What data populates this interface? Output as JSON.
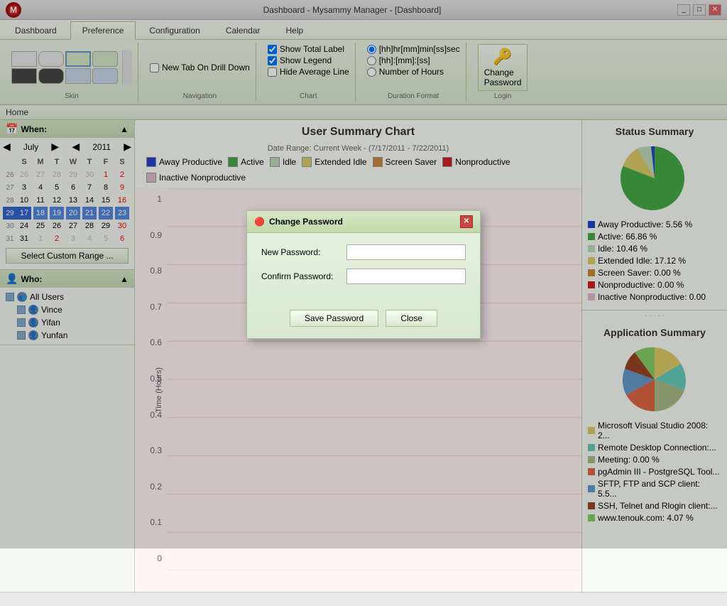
{
  "titleBar": {
    "text": "Dashboard - Mysammy Manager - [Dashboard]",
    "buttons": [
      "_",
      "□",
      "✕"
    ]
  },
  "ribbon": {
    "tabs": [
      "Dashboard",
      "Preference",
      "Configuration",
      "Calendar",
      "Help"
    ],
    "activeTab": "Preference",
    "groups": {
      "skin": {
        "label": "Skin"
      },
      "navigation": {
        "label": "Navigation",
        "newTabOnDrillDown": {
          "label": "New Tab On Drill Down",
          "checked": false
        }
      },
      "chart": {
        "label": "Chart",
        "showTotalLabel": {
          "label": "Show Total Label",
          "checked": true
        },
        "showLegend": {
          "label": "Show Legend",
          "checked": true
        },
        "hideAverageLine": {
          "label": "Hide Average Line",
          "checked": false
        }
      },
      "durationFormat": {
        "label": "Duration Format",
        "options": [
          {
            "label": "[hh]hr[mm]min[ss]sec",
            "value": "hhmmsssec",
            "checked": true
          },
          {
            "label": "[hh]:[mm]:[ss]",
            "value": "hhmmss",
            "checked": false
          },
          {
            "label": "Number of Hours",
            "value": "hours",
            "checked": false
          }
        ]
      },
      "login": {
        "label": "Login",
        "changePassword": "Change\nPassword"
      }
    }
  },
  "homeTab": "Home",
  "leftPanel": {
    "when": {
      "title": "When:",
      "month": "July",
      "year": "2011",
      "calHeaders": [
        "S",
        "M",
        "T",
        "W",
        "T",
        "F",
        "S"
      ],
      "weeks": [
        {
          "num": "26",
          "days": [
            {
              "d": "26",
              "cls": "other-month"
            },
            {
              "d": "27",
              "cls": "other-month"
            },
            {
              "d": "28",
              "cls": "other-month"
            },
            {
              "d": "29",
              "cls": "other-month"
            },
            {
              "d": "30",
              "cls": "other-month"
            },
            {
              "d": "1",
              "cls": "red"
            },
            {
              "d": "2",
              "cls": "red"
            }
          ]
        },
        {
          "num": "27",
          "days": [
            {
              "d": "3",
              "cls": ""
            },
            {
              "d": "4",
              "cls": ""
            },
            {
              "d": "5",
              "cls": ""
            },
            {
              "d": "6",
              "cls": ""
            },
            {
              "d": "7",
              "cls": ""
            },
            {
              "d": "8",
              "cls": ""
            },
            {
              "d": "9",
              "cls": "red"
            }
          ]
        },
        {
          "num": "28",
          "days": [
            {
              "d": "10",
              "cls": ""
            },
            {
              "d": "11",
              "cls": ""
            },
            {
              "d": "12",
              "cls": ""
            },
            {
              "d": "13",
              "cls": ""
            },
            {
              "d": "14",
              "cls": ""
            },
            {
              "d": "15",
              "cls": ""
            },
            {
              "d": "16",
              "cls": "red"
            }
          ]
        },
        {
          "num": "29",
          "days": [
            {
              "d": "17",
              "cls": "highlight"
            },
            {
              "d": "18",
              "cls": "highlight"
            },
            {
              "d": "19",
              "cls": "highlight"
            },
            {
              "d": "20",
              "cls": "highlight"
            },
            {
              "d": "21",
              "cls": "highlight"
            },
            {
              "d": "22",
              "cls": "highlight"
            },
            {
              "d": "23",
              "cls": "red highlight"
            }
          ]
        },
        {
          "num": "30",
          "days": [
            {
              "d": "24",
              "cls": ""
            },
            {
              "d": "25",
              "cls": ""
            },
            {
              "d": "26",
              "cls": ""
            },
            {
              "d": "27",
              "cls": ""
            },
            {
              "d": "28",
              "cls": ""
            },
            {
              "d": "29",
              "cls": ""
            },
            {
              "d": "30",
              "cls": "red"
            }
          ]
        },
        {
          "num": "31",
          "days": [
            {
              "d": "31",
              "cls": ""
            },
            {
              "d": "1",
              "cls": "other-month"
            },
            {
              "d": "2",
              "cls": "other-month red"
            },
            {
              "d": "3",
              "cls": "other-month"
            },
            {
              "d": "4",
              "cls": "other-month"
            },
            {
              "d": "5",
              "cls": "other-month"
            },
            {
              "d": "6",
              "cls": "other-month red"
            }
          ]
        }
      ],
      "customRangeBtn": "Select Custom Range ..."
    },
    "who": {
      "title": "Who:",
      "users": [
        {
          "name": "All Users",
          "level": 0
        },
        {
          "name": "Vince",
          "level": 1
        },
        {
          "name": "Yifan",
          "level": 1
        },
        {
          "name": "Yunfan",
          "level": 1
        }
      ]
    }
  },
  "chart": {
    "title": "User Summary Chart",
    "dateRange": "Date Range: Current Week - (7/17/2011 - 7/22/2011)",
    "legend": [
      {
        "label": "Away Productive",
        "color": "#2244cc"
      },
      {
        "label": "Active",
        "color": "#44aa44"
      },
      {
        "label": "Idle",
        "color": "#bbddbb"
      },
      {
        "label": "Extended Idle",
        "color": "#ddcc66"
      },
      {
        "label": "Screen Saver",
        "color": "#cc8833"
      },
      {
        "label": "Nonproductive",
        "color": "#cc2222"
      },
      {
        "label": "Inactive Nonproductive",
        "color": "#ddbbcc"
      }
    ],
    "yAxis": [
      "1",
      "0.9",
      "0.8",
      "0.7",
      "0.6",
      "0.5",
      "0.4",
      "0.3",
      "0.2",
      "0.1",
      "0"
    ]
  },
  "statusSummary": {
    "title": "Status Summary",
    "legend": [
      {
        "label": "Away Productive: 5.56 %",
        "color": "#2244cc"
      },
      {
        "label": "Active: 66.86 %",
        "color": "#44aa44"
      },
      {
        "label": "Idle: 10.46 %",
        "color": "#bbddbb"
      },
      {
        "label": "Extended Idle: 17.12 %",
        "color": "#ddcc66"
      },
      {
        "label": "Screen Saver: 0.00 %",
        "color": "#cc8833"
      },
      {
        "label": "Nonproductive: 0.00 %",
        "color": "#cc2222"
      },
      {
        "label": "Inactive Nonproductive: 0.00",
        "color": "#ddbbcc"
      }
    ],
    "pie": {
      "segments": [
        {
          "color": "#44aa44",
          "pct": 66.86,
          "startAngle": 0
        },
        {
          "color": "#ddcc66",
          "pct": 17.12,
          "startAngle": 240
        },
        {
          "color": "#bbddbb",
          "pct": 10.46,
          "startAngle": 301
        },
        {
          "color": "#2244cc",
          "pct": 5.56,
          "startAngle": 339
        },
        {
          "color": "#cc2222",
          "pct": 0,
          "startAngle": 358
        }
      ]
    }
  },
  "appSummary": {
    "title": "Application Summary",
    "legend": [
      {
        "label": "Microsoft Visual Studio 2008: 2...",
        "color": "#ddcc66"
      },
      {
        "label": "Remote Desktop Connection:...",
        "color": "#66ccbb"
      },
      {
        "label": "Meeting: 0.00 %",
        "color": "#aabb88"
      },
      {
        "label": "pgAdmin III - PostgreSQL Tool...",
        "color": "#dd6644"
      },
      {
        "label": "SFTP, FTP and SCP client: 5.5...",
        "color": "#6699cc"
      },
      {
        "label": "SSH, Telnet and Rlogin client:...",
        "color": "#994422"
      },
      {
        "label": "www.tenouk.com: 4.07 %",
        "color": "#88cc66"
      }
    ]
  },
  "modal": {
    "title": "Change Password",
    "newPasswordLabel": "New Password:",
    "confirmPasswordLabel": "Confirm Password:",
    "saveBtn": "Save Password",
    "closeBtn": "Close"
  },
  "statusBar": {
    "text": ""
  }
}
